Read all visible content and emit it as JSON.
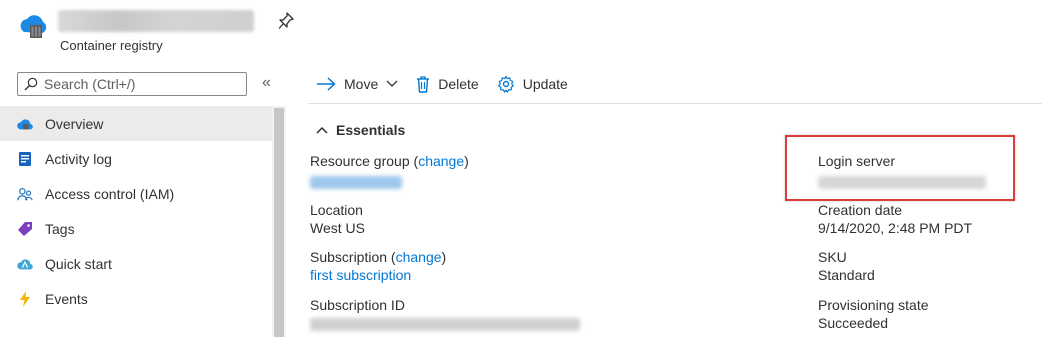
{
  "header": {
    "subtitle": "Container registry"
  },
  "sidebar": {
    "search_placeholder": "Search (Ctrl+/)",
    "collapse_label": "«",
    "items": [
      {
        "label": "Overview",
        "icon": "cloud-icon",
        "active": true
      },
      {
        "label": "Activity log",
        "icon": "activity-log-icon"
      },
      {
        "label": "Access control (IAM)",
        "icon": "people-icon"
      },
      {
        "label": "Tags",
        "icon": "tag-icon"
      },
      {
        "label": "Quick start",
        "icon": "quick-start-icon"
      },
      {
        "label": "Events",
        "icon": "lightning-icon"
      }
    ]
  },
  "toolbar": {
    "move_label": "Move",
    "delete_label": "Delete",
    "update_label": "Update"
  },
  "essentials": {
    "heading": "Essentials",
    "resource_group_label": "Resource group",
    "change_label": "change",
    "location_label": "Location",
    "location_value": "West US",
    "subscription_label": "Subscription",
    "subscription_value": "first subscription",
    "subscription_id_label": "Subscription ID",
    "login_server_label": "Login server",
    "creation_date_label": "Creation date",
    "creation_date_value": "9/14/2020, 2:48 PM PDT",
    "sku_label": "SKU",
    "sku_value": "Standard",
    "provisioning_label": "Provisioning state",
    "provisioning_value": "Succeeded"
  },
  "colors": {
    "accent": "#0078d4",
    "highlight": "#e03c3c"
  }
}
